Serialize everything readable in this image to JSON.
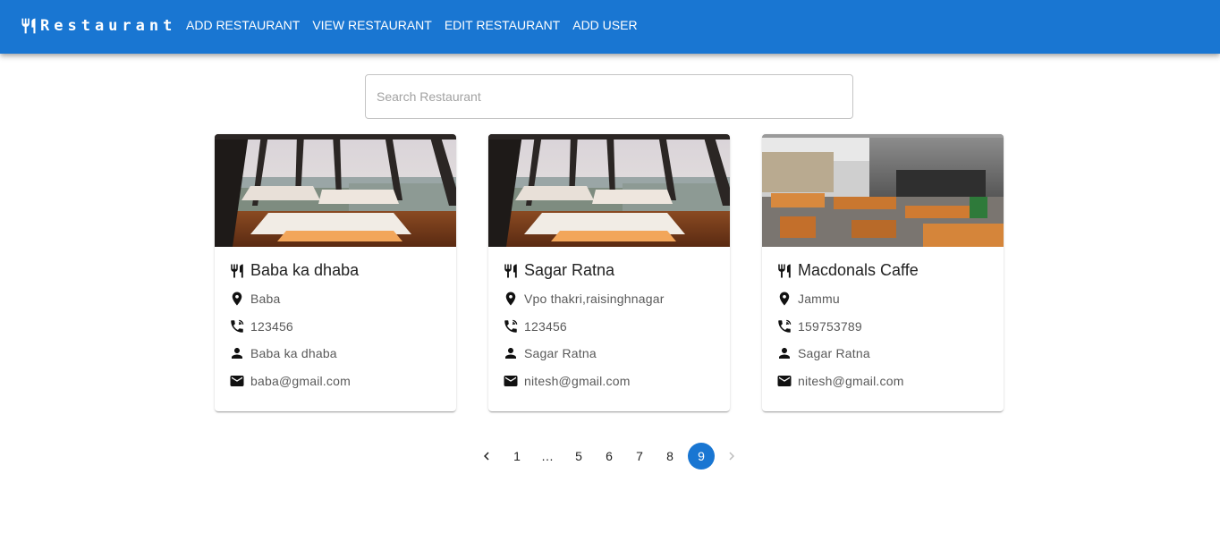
{
  "header": {
    "brand": "Restaurant",
    "nav": [
      {
        "label": "ADD RESTAURANT"
      },
      {
        "label": "VIEW RESTAURANT"
      },
      {
        "label": "EDIT RESTAURANT"
      },
      {
        "label": "ADD USER"
      }
    ]
  },
  "search": {
    "placeholder": "Search Restaurant",
    "value": ""
  },
  "cards": [
    {
      "name": "Baba ka dhaba",
      "address": "Baba",
      "phone": "123456",
      "owner": "Baba ka dhaba",
      "email": "baba@gmail.com"
    },
    {
      "name": "Sagar Ratna",
      "address": "Vpo thakri,raisinghnagar",
      "phone": "123456",
      "owner": "Sagar Ratna",
      "email": "nitesh@gmail.com"
    },
    {
      "name": "Macdonals Caffe",
      "address": "Jammu",
      "phone": "159753789",
      "owner": "Sagar Ratna",
      "email": "nitesh@gmail.com"
    }
  ],
  "pagination": {
    "items": [
      "1",
      "…",
      "5",
      "6",
      "7",
      "8",
      "9"
    ],
    "current": "9"
  },
  "colors": {
    "primary": "#1976d2",
    "text_secondary": "#595959"
  },
  "icons": {
    "brand": "restaurant-icon",
    "address": "location-pin-icon",
    "phone": "phone-icon",
    "owner": "person-icon",
    "email": "mail-icon",
    "prev": "chevron-left-icon",
    "next": "chevron-right-icon"
  }
}
